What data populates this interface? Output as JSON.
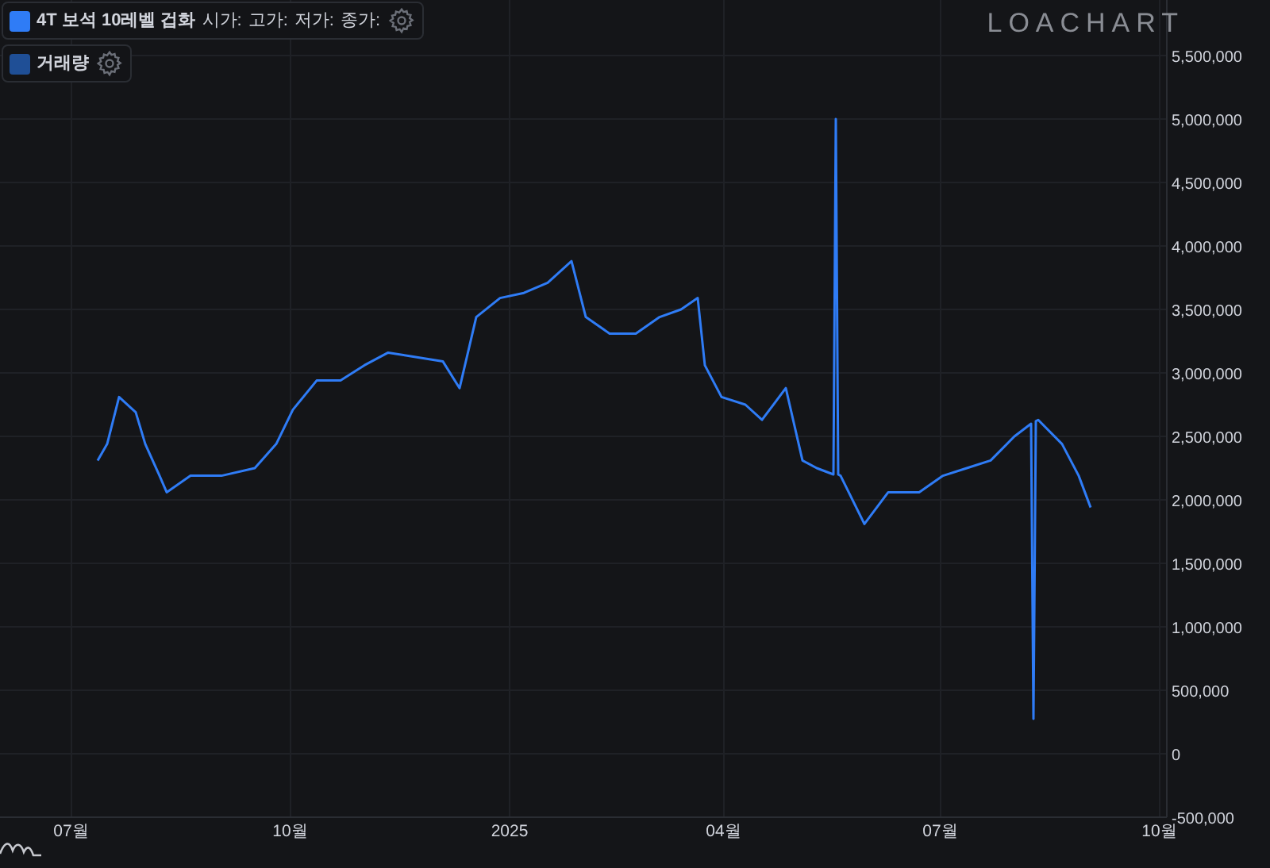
{
  "legend": [
    {
      "color": "#2f7cf6",
      "name": "4T 보석 10레벨 겁화",
      "fields": [
        "시가:",
        "고가:",
        "저가:",
        "종가:"
      ]
    },
    {
      "color": "#1f4f96",
      "name": "거래량"
    }
  ],
  "watermark": "LOACHART",
  "chart_data": {
    "type": "line",
    "grid": true,
    "x": [
      "2024-07-12",
      "2024-07-16",
      "2024-07-21",
      "2024-07-28",
      "2024-08-01",
      "2024-08-07",
      "2024-08-10",
      "2024-08-20",
      "2024-09-02",
      "2024-09-16",
      "2024-09-25",
      "2024-10-02",
      "2024-10-12",
      "2024-10-22",
      "2024-11-01",
      "2024-11-11",
      "2024-11-21",
      "2024-12-04",
      "2024-12-11",
      "2024-12-18",
      "2024-12-28",
      "2025-01-07",
      "2025-01-17",
      "2025-01-27",
      "2025-02-02",
      "2025-02-12",
      "2025-02-23",
      "2025-03-05",
      "2025-03-14",
      "2025-03-21",
      "2025-03-24",
      "2025-03-31",
      "2025-04-10",
      "2025-04-17",
      "2025-04-27",
      "2025-05-04",
      "2025-05-10",
      "2025-05-17",
      "2025-05-18",
      "2025-05-19",
      "2025-05-20",
      "2025-05-30",
      "2025-06-09",
      "2025-06-22",
      "2025-07-02",
      "2025-07-12",
      "2025-07-22",
      "2025-08-01",
      "2025-08-08",
      "2025-08-09",
      "2025-08-10",
      "2025-08-11",
      "2025-08-21",
      "2025-08-28",
      "2025-09-02"
    ],
    "series": [
      {
        "color": "#2f7cf6",
        "values": [
          2310000,
          2440000,
          2810000,
          2690000,
          2440000,
          2190000,
          2060000,
          2190000,
          2190000,
          2250000,
          2440000,
          2710000,
          2940000,
          2940000,
          3060000,
          3160000,
          3130000,
          3090000,
          2880000,
          3440000,
          3590000,
          3630000,
          3710000,
          3880000,
          3440000,
          3310000,
          3310000,
          3440000,
          3500000,
          3590000,
          3060000,
          2810000,
          2750000,
          2630000,
          2880000,
          2310000,
          2250000,
          2200000,
          5000000,
          2200000,
          2190000,
          1810000,
          2060000,
          2060000,
          2190000,
          2250000,
          2310000,
          2500000,
          2600000,
          275000,
          2620000,
          2630000,
          2440000,
          2190000,
          1940000
        ]
      }
    ],
    "xlim": [
      "2024-06-01",
      "2025-10-04"
    ],
    "ylim": [
      -500000,
      5937500
    ],
    "xticks": [
      {
        "value": "2024-07-01",
        "label": "07월"
      },
      {
        "value": "2024-10-01",
        "label": "10월"
      },
      {
        "value": "2025-01-01",
        "label": "2025"
      },
      {
        "value": "2025-04-01",
        "label": "04월"
      },
      {
        "value": "2025-07-01",
        "label": "07월"
      },
      {
        "value": "2025-10-01",
        "label": "10월"
      }
    ],
    "yticks": [
      {
        "value": 5500000,
        "label": "5,500,000"
      },
      {
        "value": 5000000,
        "label": "5,000,000"
      },
      {
        "value": 4500000,
        "label": "4,500,000"
      },
      {
        "value": 4000000,
        "label": "4,000,000"
      },
      {
        "value": 3500000,
        "label": "3,500,000"
      },
      {
        "value": 3000000,
        "label": "3,000,000"
      },
      {
        "value": 2500000,
        "label": "2,500,000"
      },
      {
        "value": 2000000,
        "label": "2,000,000"
      },
      {
        "value": 1500000,
        "label": "1,500,000"
      },
      {
        "value": 1000000,
        "label": "1,000,000"
      },
      {
        "value": 500000,
        "label": "500,000"
      },
      {
        "value": 0,
        "label": "0"
      },
      {
        "value": -500000,
        "label": "-500,000"
      }
    ]
  }
}
